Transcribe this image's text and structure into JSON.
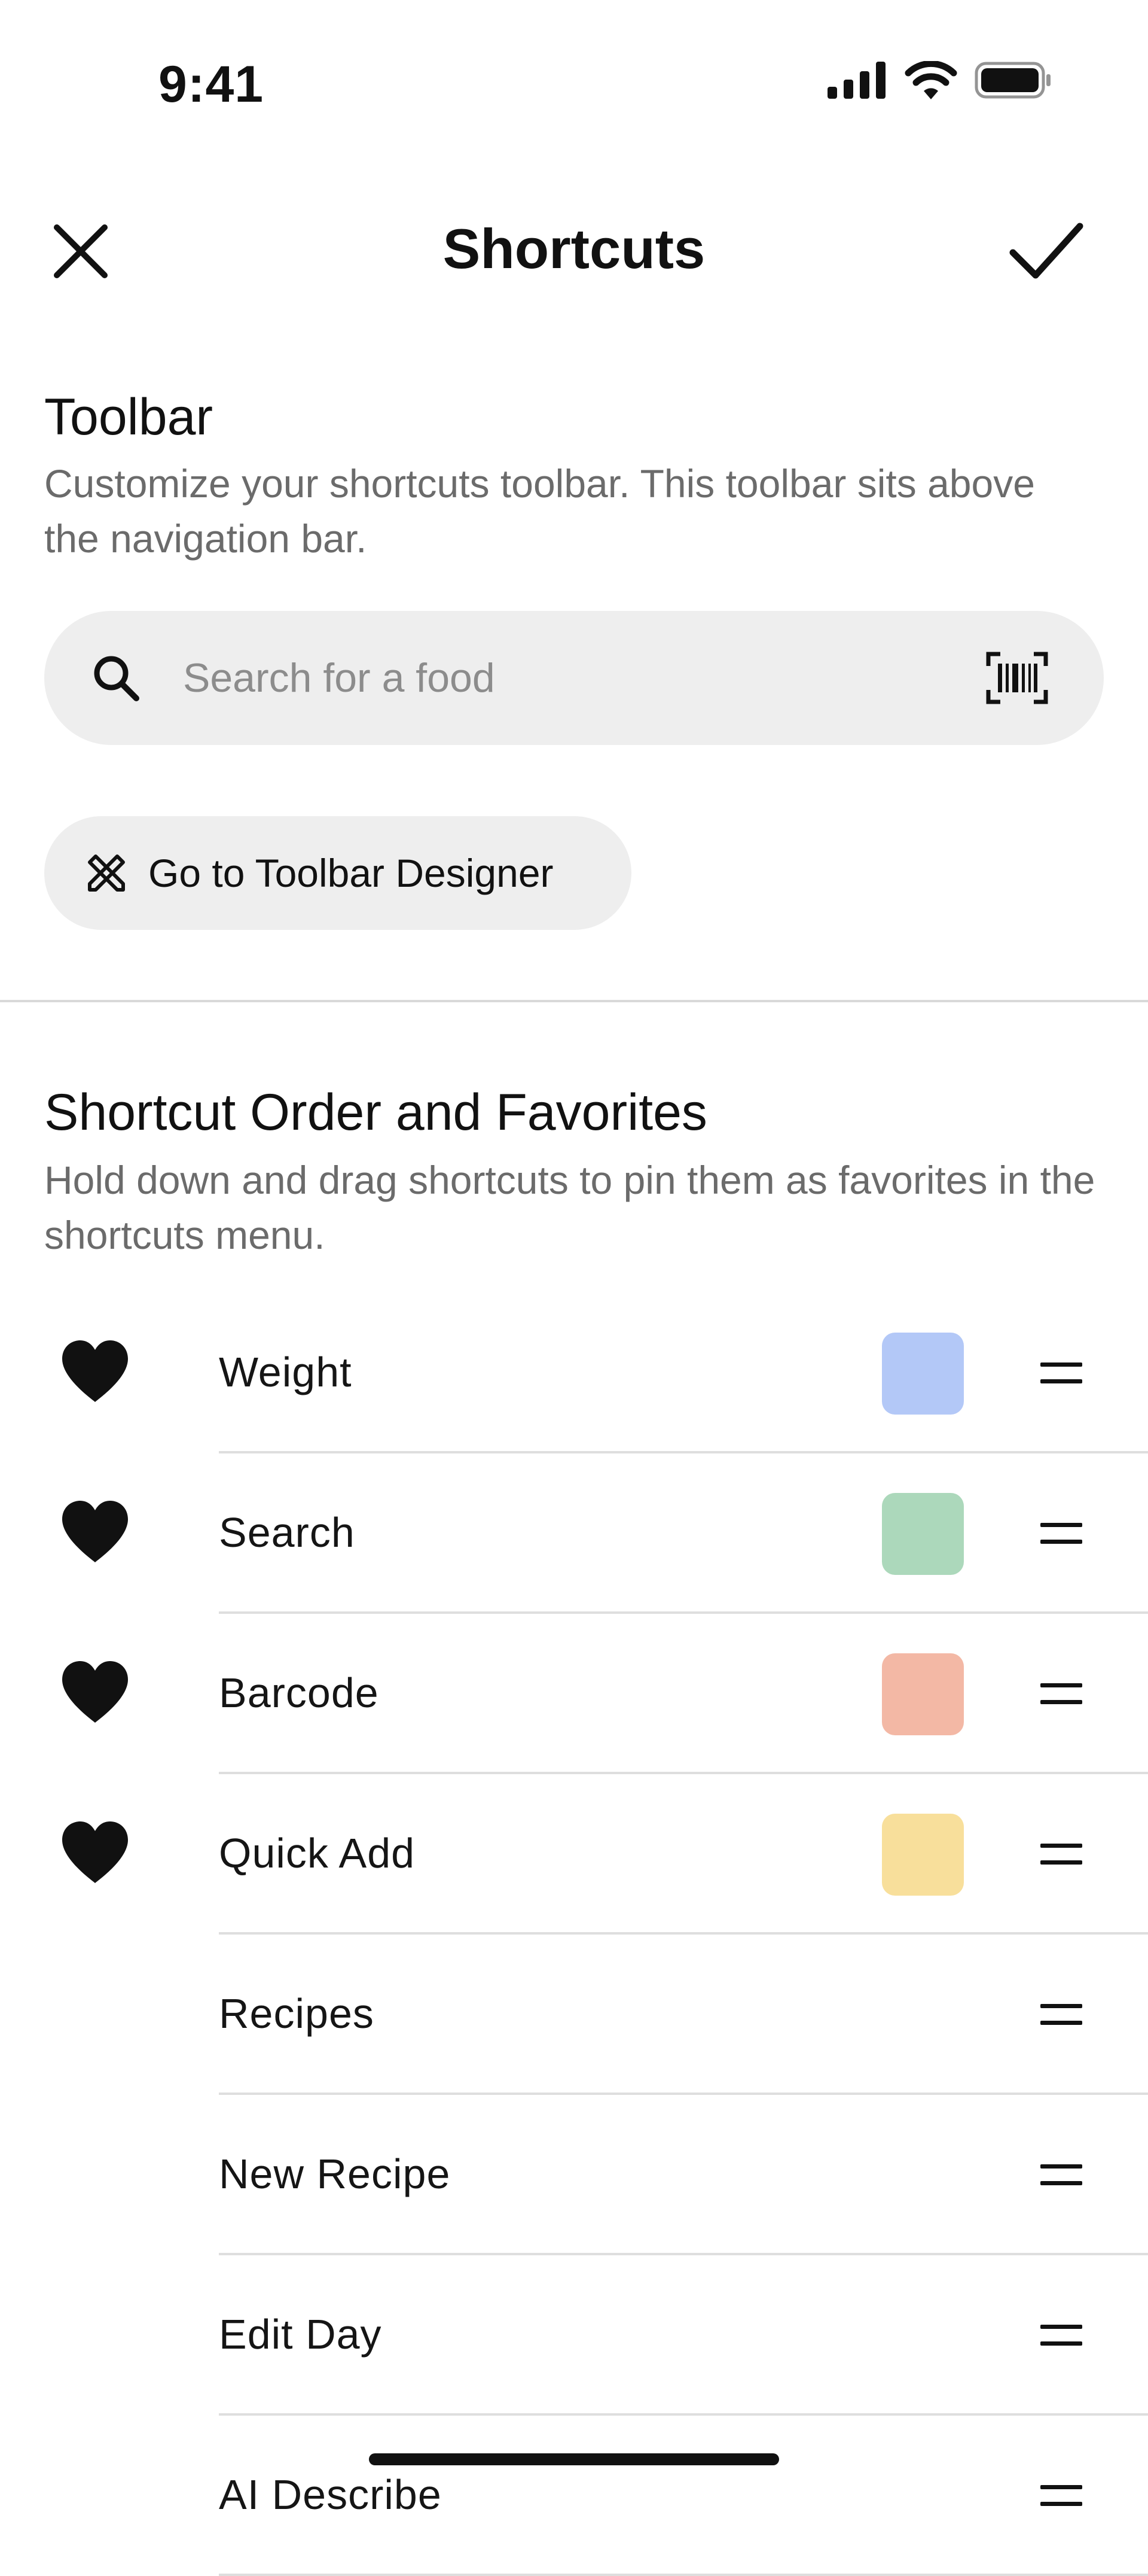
{
  "status_bar": {
    "time": "9:41"
  },
  "header": {
    "title": "Shortcuts"
  },
  "toolbar_section": {
    "title": "Toolbar",
    "description": "Customize your shortcuts toolbar. This toolbar sits above the navigation bar.",
    "search": {
      "placeholder": "Search for a food",
      "value": ""
    },
    "designer_button_label": "Go to Toolbar Designer"
  },
  "order_section": {
    "title": "Shortcut Order and Favorites",
    "description": "Hold down and drag shortcuts to pin them as favorites in the shortcuts menu.",
    "items": [
      {
        "label": "Weight",
        "favorite": true,
        "color": "#b3c8f7"
      },
      {
        "label": "Search",
        "favorite": true,
        "color": "#acd8bb"
      },
      {
        "label": "Barcode",
        "favorite": true,
        "color": "#f3b8a5"
      },
      {
        "label": "Quick Add",
        "favorite": true,
        "color": "#f8df9b"
      },
      {
        "label": "Recipes",
        "favorite": false,
        "color": null
      },
      {
        "label": "New Recipe",
        "favorite": false,
        "color": null
      },
      {
        "label": "Edit Day",
        "favorite": false,
        "color": null
      },
      {
        "label": "AI Describe",
        "favorite": false,
        "color": null
      }
    ]
  },
  "icons": {
    "close": "close-icon",
    "confirm": "checkmark-icon",
    "search": "search-icon",
    "barcode": "barcode-scan-icon",
    "designer": "design-tools-icon",
    "favorite": "heart-icon",
    "drag": "drag-handle-icon"
  }
}
